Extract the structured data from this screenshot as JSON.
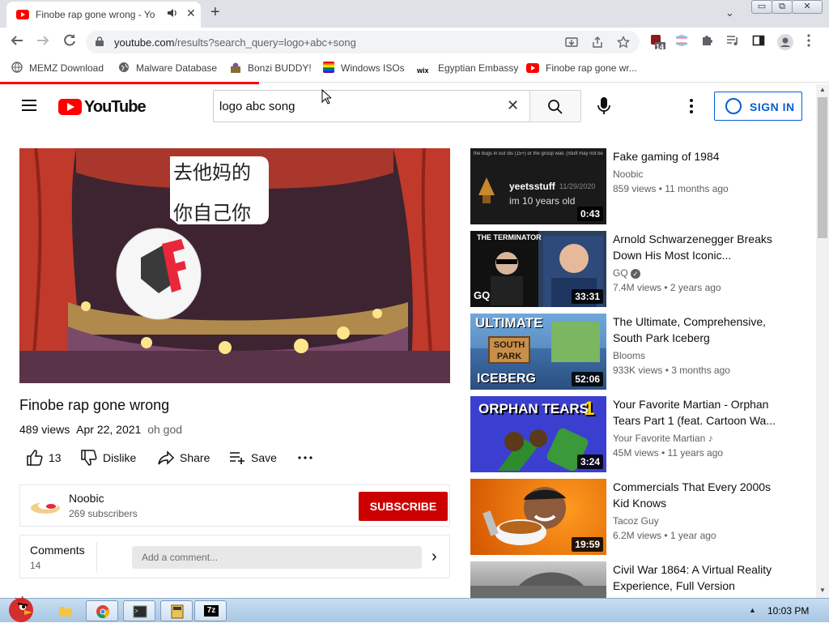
{
  "browser": {
    "tab_title": "Finobe rap gone wrong - Yo",
    "tab_close": "✕",
    "new_tab": "+",
    "tab_search": "⌄",
    "url_host": "youtube.com",
    "url_path": "/results?search_query=logo+abc+song",
    "window_buttons": [
      "▭",
      "⧉",
      "✕"
    ],
    "extension_badge": "14",
    "bookmarks": [
      {
        "label": "MEMZ Download",
        "icon": "globe-icon",
        "color": "#ffffff"
      },
      {
        "label": "Malware Database",
        "icon": "globe-icon",
        "color": "#ffffff"
      },
      {
        "label": "Bonzi BUDDY!",
        "icon": "bonzi-icon",
        "color": "#8a6d2e"
      },
      {
        "label": "Windows ISOs",
        "icon": "rainbow-icon",
        "color": "#e04040"
      },
      {
        "label": "Egyptian Embassy",
        "icon": "wix-icon",
        "color": "#000000"
      },
      {
        "label": "Finobe rap gone wr...",
        "icon": "youtube-icon",
        "color": "#ff0000"
      }
    ]
  },
  "youtube": {
    "logo_text": "YouTube",
    "search_value": "logo abc song",
    "clear_icon": "✕",
    "signin_label": "SIGN IN"
  },
  "video": {
    "overlay_text_line1": "去他妈的",
    "overlay_text_line2": "你自己你",
    "title": "Finobe rap gone wrong",
    "views": "489 views",
    "date": "Apr 22, 2021",
    "tag": "oh god",
    "likes": "13",
    "dislike_label": "Dislike",
    "share_label": "Share",
    "save_label": "Save",
    "more_label": "..."
  },
  "channel": {
    "name": "Noobic",
    "subscribers": "269 subscribers",
    "subscribe_label": "SUBSCRIBE"
  },
  "comments": {
    "heading": "Comments",
    "count": "14",
    "placeholder": "Add a comment...",
    "chevron": "›"
  },
  "related": [
    {
      "title": "Fake gaming of 1984",
      "channel": "Noobic",
      "stats": "859 views • 11 months ago",
      "duration": "0:43",
      "thumb_text1": "yeetsstuff",
      "thumb_text2": "im 10 years old",
      "thumb_text3": "11/29/2020",
      "thumb_caption": "the bugs in our dis (15+) or the group wall. (Stuff may not be accurate)"
    },
    {
      "title": "Arnold Schwarzenegger Breaks Down His Most Iconic...",
      "channel": "GQ",
      "stats": "7.4M views • 2 years ago",
      "duration": "33:31",
      "thumb_text1": "THE TERMINATOR",
      "thumb_text2": "GQ",
      "verified": "✓"
    },
    {
      "title": "The Ultimate, Comprehensive, South Park Iceberg",
      "channel": "Blooms",
      "stats": "933K views • 3 months ago",
      "duration": "52:06",
      "thumb_text1": "ULTIMATE",
      "thumb_text2": "SOUTH PARK",
      "thumb_text3": "ICEBERG"
    },
    {
      "title": "Your Favorite Martian - Orphan Tears Part 1 (feat. Cartoon Wa...",
      "channel": "Your Favorite Martian",
      "stats": "45M views • 11 years ago",
      "duration": "3:24",
      "thumb_text1": "ORPHAN TEARS",
      "thumb_text2": "1",
      "music": "♪"
    },
    {
      "title": "Commercials That Every 2000s Kid Knows",
      "channel": "Tacoz Guy",
      "stats": "6.2M views • 1 year ago",
      "duration": "19:59"
    },
    {
      "title": "Civil War 1864: A Virtual Reality Experience, Full Version",
      "channel": "",
      "stats": "",
      "duration": ""
    }
  ],
  "taskbar": {
    "clock": "10:03 PM",
    "tray_arrow": "▲",
    "items": [
      "angry-bird-icon",
      "folder-icon",
      "chrome-icon",
      "terminal-icon",
      "calculator-icon",
      "7zip-icon"
    ],
    "item_7z": "7z"
  },
  "colors": {
    "youtube_red": "#ff0000",
    "subscribe_red": "#cc0000",
    "signin_blue": "#065fd4"
  }
}
